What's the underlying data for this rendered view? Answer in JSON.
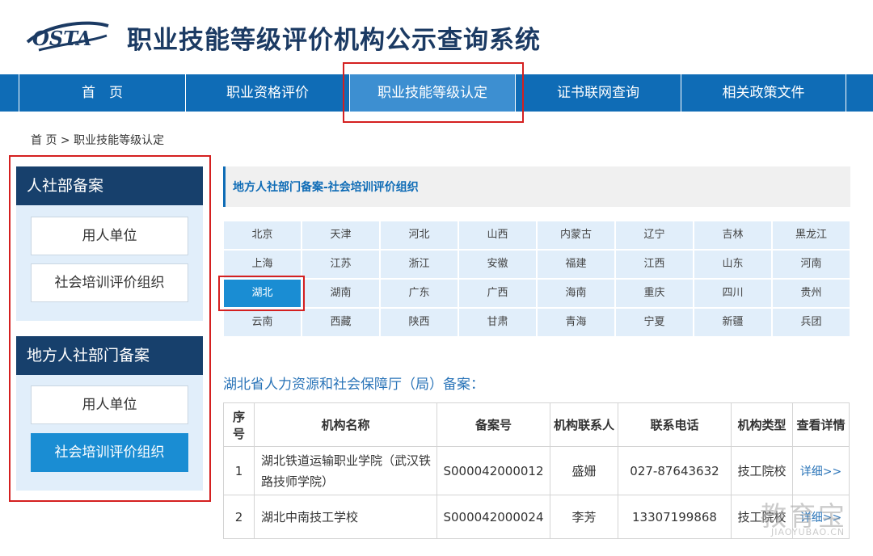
{
  "header": {
    "logo_text": "OSTA",
    "title": "职业技能等级评价机构公示查询系统"
  },
  "nav": {
    "items": [
      {
        "label": "首　页"
      },
      {
        "label": "职业资格评价"
      },
      {
        "label": "职业技能等级认定"
      },
      {
        "label": "证书联网查询"
      },
      {
        "label": "相关政策文件"
      }
    ],
    "active_index": 2
  },
  "breadcrumb": {
    "home": "首 页",
    "sep": ">",
    "current": "职业技能等级认定"
  },
  "sidebar": {
    "sections": [
      {
        "title": "人社部备案",
        "items": [
          "用人单位",
          "社会培训评价组织"
        ]
      },
      {
        "title": "地方人社部门备案",
        "items": [
          "用人单位",
          "社会培训评价组织"
        ]
      }
    ]
  },
  "main": {
    "title": "地方人社部门备案-社会培训评价组织",
    "regions": [
      [
        "北京",
        "天津",
        "河北",
        "山西",
        "内蒙古",
        "辽宁",
        "吉林",
        "黑龙江"
      ],
      [
        "上海",
        "江苏",
        "浙江",
        "安徽",
        "福建",
        "江西",
        "山东",
        "河南"
      ],
      [
        "湖北",
        "湖南",
        "广东",
        "广西",
        "海南",
        "重庆",
        "四川",
        "贵州"
      ],
      [
        "云南",
        "西藏",
        "陕西",
        "甘肃",
        "青海",
        "宁夏",
        "新疆",
        "兵团"
      ]
    ],
    "selected_region": "湖北",
    "sub_title": "湖北省人力资源和社会保障厅（局）备案：",
    "table": {
      "headers": [
        "序号",
        "机构名称",
        "备案号",
        "机构联系人",
        "联系电话",
        "机构类型",
        "查看详情"
      ],
      "rows": [
        {
          "no": "1",
          "name": "湖北铁道运输职业学院（武汉铁路技师学院）",
          "code": "S000042000012",
          "contact": "盛姗",
          "phone": "027-87643632",
          "type": "技工院校",
          "detail": "详细>>"
        },
        {
          "no": "2",
          "name": "湖北中南技工学校",
          "code": "S000042000024",
          "contact": "李芳",
          "phone": "13307199868",
          "type": "技工院校",
          "detail": "详细>>"
        }
      ]
    }
  },
  "watermark": {
    "big": "教育宝",
    "small": "JIAOYUBAO.CN"
  },
  "colors": {
    "nav_bg": "#0f6cb6",
    "nav_active": "#3d8fd1",
    "side_head": "#17406c",
    "accent": "#1a8dd3",
    "highlight_red": "#d42020"
  }
}
